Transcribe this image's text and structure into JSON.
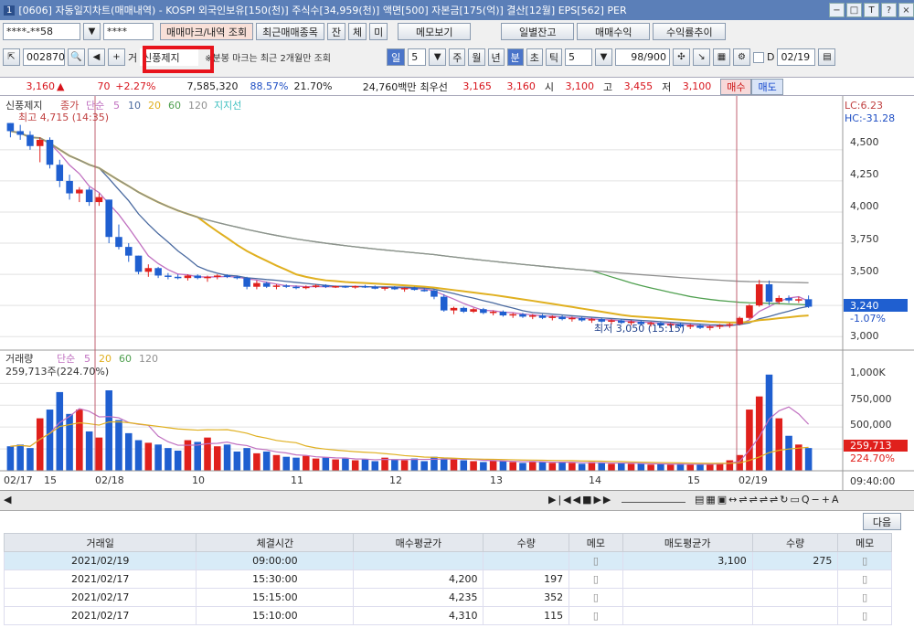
{
  "window": {
    "number": "1",
    "title": "[0606] 자동일지차트(매매내역) - KOSPI 외국인보유[150(천)] 주식수[34,959(천)] 액면[500] 자본금[175(억)] 결산[12월] EPS[562] PER",
    "controls": [
      "−",
      "□",
      "T",
      "?",
      "×"
    ]
  },
  "toolbar1": {
    "account": "****-**58",
    "password": "****",
    "btn_trade_history": "매매마크/내역 조회",
    "btn_recent": "최근매매종목",
    "btn_jan": "잔",
    "btn_che": "체",
    "btn_mi": "미",
    "btn_memo": "메모보기",
    "btn_daily_balance": "일별잔고",
    "btn_profit": "매매수익",
    "btn_return": "수익률추이"
  },
  "toolbar2": {
    "code": "002870",
    "name_prefix": "거",
    "stock_name": "신풍제지",
    "notice": "※분봉 마크는 최근 2개월만 조회",
    "period_day": "일",
    "period_val": "5",
    "period_week": "주",
    "period_month": "월",
    "period_year": "년",
    "period_min": "분",
    "period_sec": "초",
    "period_tick": "틱",
    "tick_val": "5",
    "count": "98/900",
    "date_label": "D",
    "date": "02/19"
  },
  "quote": {
    "price": "3,160",
    "change": "70",
    "pct": "+2.27%",
    "volume": "7,585,320",
    "ratio": "88.57%",
    "turnover": "21.70%",
    "amount": "24,760백만",
    "best_label": "최우선",
    "best_ask": "3,165",
    "best_bid": "3,160",
    "open_label": "시",
    "open": "3,100",
    "high_label": "고",
    "high": "3,455",
    "low_label": "저",
    "low": "3,100",
    "buy": "매수",
    "sell": "매도"
  },
  "chart": {
    "price_legend": [
      "신풍제지",
      "종가",
      "단순",
      "5",
      "10",
      "20",
      "60",
      "120",
      "지지선"
    ],
    "high_note": "최고 4,715 (14:35)",
    "low_note": "최저 3,050 (15:15)",
    "lc": "LC:6.23",
    "hc": "HC:-31.28",
    "price_ticks": [
      "4,500",
      "4,250",
      "4,000",
      "3,750",
      "3,500",
      "3,000"
    ],
    "current_price": "3,240",
    "current_pct": "-1.07%",
    "vol_legend": [
      "거래량",
      "단순",
      "5",
      "20",
      "60",
      "120"
    ],
    "vol_note": "259,713주(224.70%)",
    "vol_ticks": [
      "1,000K",
      "750,000",
      "500,000"
    ],
    "vol_current": "259,713",
    "vol_current_pct": "224.70%",
    "x_labels": [
      "02/17",
      "15",
      "02/18",
      "10",
      "11",
      "12",
      "13",
      "14",
      "15",
      "02/19"
    ],
    "time_label": "09:40:00",
    "colors": {
      "up": "#e0201c",
      "down": "#1f5fd0",
      "ma5": "#c070c0",
      "ma10": "#4a6aa0",
      "ma20": "#e0b020",
      "ma60": "#50a050",
      "ma120": "#909090",
      "support": "#40c0c0"
    }
  },
  "chart_data": {
    "type": "candlestick",
    "price_min": 2950,
    "price_max": 4800,
    "candles": [
      [
        4715,
        4715,
        4600,
        4650
      ],
      [
        4650,
        4700,
        4580,
        4620
      ],
      [
        4620,
        4650,
        4500,
        4530
      ],
      [
        4530,
        4600,
        4400,
        4580
      ],
      [
        4580,
        4600,
        4350,
        4380
      ],
      [
        4380,
        4420,
        4200,
        4250
      ],
      [
        4250,
        4300,
        4100,
        4150
      ],
      [
        4150,
        4200,
        4080,
        4180
      ],
      [
        4180,
        4200,
        4050,
        4080
      ],
      [
        4080,
        4150,
        4050,
        4120
      ],
      [
        4100,
        4100,
        3750,
        3800
      ],
      [
        3800,
        3900,
        3700,
        3720
      ],
      [
        3720,
        3750,
        3600,
        3650
      ],
      [
        3650,
        3650,
        3500,
        3520
      ],
      [
        3520,
        3580,
        3480,
        3550
      ],
      [
        3550,
        3560,
        3470,
        3490
      ],
      [
        3490,
        3510,
        3460,
        3480
      ],
      [
        3480,
        3500,
        3460,
        3470
      ],
      [
        3470,
        3500,
        3450,
        3490
      ],
      [
        3490,
        3500,
        3460,
        3470
      ],
      [
        3470,
        3490,
        3440,
        3480
      ],
      [
        3480,
        3500,
        3460,
        3490
      ],
      [
        3490,
        3500,
        3470,
        3480
      ],
      [
        3480,
        3490,
        3460,
        3470
      ],
      [
        3470,
        3480,
        3380,
        3400
      ],
      [
        3400,
        3450,
        3380,
        3430
      ],
      [
        3430,
        3440,
        3390,
        3400
      ],
      [
        3400,
        3420,
        3380,
        3410
      ],
      [
        3410,
        3420,
        3390,
        3400
      ],
      [
        3400,
        3410,
        3380,
        3390
      ],
      [
        3390,
        3410,
        3380,
        3400
      ],
      [
        3400,
        3420,
        3390,
        3410
      ],
      [
        3410,
        3420,
        3390,
        3400
      ],
      [
        3400,
        3410,
        3390,
        3405
      ],
      [
        3405,
        3410,
        3390,
        3395
      ],
      [
        3395,
        3410,
        3385,
        3405
      ],
      [
        3405,
        3415,
        3390,
        3400
      ],
      [
        3400,
        3410,
        3380,
        3385
      ],
      [
        3385,
        3400,
        3370,
        3395
      ],
      [
        3395,
        3405,
        3375,
        3380
      ],
      [
        3380,
        3395,
        3360,
        3390
      ],
      [
        3390,
        3400,
        3370,
        3375
      ],
      [
        3375,
        3390,
        3360,
        3370
      ],
      [
        3370,
        3380,
        3300,
        3320
      ],
      [
        3320,
        3340,
        3200,
        3210
      ],
      [
        3210,
        3240,
        3180,
        3230
      ],
      [
        3230,
        3240,
        3190,
        3200
      ],
      [
        3200,
        3230,
        3190,
        3220
      ],
      [
        3220,
        3230,
        3180,
        3190
      ],
      [
        3190,
        3210,
        3170,
        3200
      ],
      [
        3200,
        3210,
        3160,
        3170
      ],
      [
        3170,
        3190,
        3150,
        3180
      ],
      [
        3180,
        3190,
        3150,
        3160
      ],
      [
        3160,
        3180,
        3140,
        3170
      ],
      [
        3170,
        3180,
        3140,
        3150
      ],
      [
        3150,
        3170,
        3130,
        3160
      ],
      [
        3160,
        3170,
        3130,
        3140
      ],
      [
        3140,
        3160,
        3120,
        3150
      ],
      [
        3150,
        3160,
        3120,
        3130
      ],
      [
        3130,
        3150,
        3110,
        3140
      ],
      [
        3140,
        3150,
        3110,
        3120
      ],
      [
        3120,
        3140,
        3100,
        3130
      ],
      [
        3130,
        3140,
        3100,
        3110
      ],
      [
        3110,
        3130,
        3090,
        3120
      ],
      [
        3120,
        3130,
        3090,
        3100
      ],
      [
        3100,
        3120,
        3080,
        3110
      ],
      [
        3110,
        3120,
        3080,
        3090
      ],
      [
        3090,
        3110,
        3070,
        3100
      ],
      [
        3100,
        3110,
        3070,
        3080
      ],
      [
        3080,
        3100,
        3060,
        3090
      ],
      [
        3090,
        3100,
        3060,
        3070
      ],
      [
        3070,
        3090,
        3050,
        3080
      ],
      [
        3080,
        3100,
        3060,
        3090
      ],
      [
        3090,
        3110,
        3070,
        3100
      ],
      [
        3100,
        3160,
        3090,
        3150
      ],
      [
        3150,
        3260,
        3140,
        3250
      ],
      [
        3250,
        3455,
        3240,
        3420
      ],
      [
        3420,
        3450,
        3250,
        3280
      ],
      [
        3280,
        3330,
        3260,
        3310
      ],
      [
        3310,
        3330,
        3270,
        3290
      ],
      [
        3290,
        3320,
        3270,
        3300
      ],
      [
        3300,
        3330,
        3230,
        3240
      ]
    ],
    "volumes": [
      280,
      300,
      260,
      600,
      700,
      900,
      650,
      700,
      450,
      380,
      920,
      580,
      430,
      350,
      320,
      300,
      260,
      230,
      350,
      330,
      380,
      280,
      300,
      220,
      260,
      200,
      220,
      180,
      160,
      150,
      170,
      140,
      150,
      130,
      140,
      120,
      130,
      110,
      150,
      130,
      120,
      140,
      110,
      160,
      140,
      130,
      120,
      110,
      100,
      120,
      110,
      100,
      90,
      110,
      100,
      90,
      100,
      90,
      80,
      100,
      90,
      80,
      90,
      80,
      80,
      70,
      80,
      70,
      80,
      70,
      70,
      80,
      90,
      120,
      180,
      700,
      850,
      1100,
      600,
      400,
      300,
      260
    ],
    "vol_max": 1150
  },
  "table": {
    "headers": [
      "거래일",
      "체결시간",
      "매수평균가",
      "수량",
      "메모",
      "매도평균가",
      "수량",
      "메모"
    ],
    "next_btn": "다음",
    "rows": [
      [
        "2021/02/19",
        "09:00:00",
        "",
        "",
        "",
        "3,100",
        "275",
        ""
      ],
      [
        "2021/02/17",
        "15:30:00",
        "4,200",
        "197",
        "",
        "",
        "",
        ""
      ],
      [
        "2021/02/17",
        "15:15:00",
        "4,235",
        "352",
        "",
        "",
        "",
        ""
      ],
      [
        "2021/02/17",
        "15:10:00",
        "4,310",
        "115",
        "",
        "",
        "",
        ""
      ]
    ]
  }
}
